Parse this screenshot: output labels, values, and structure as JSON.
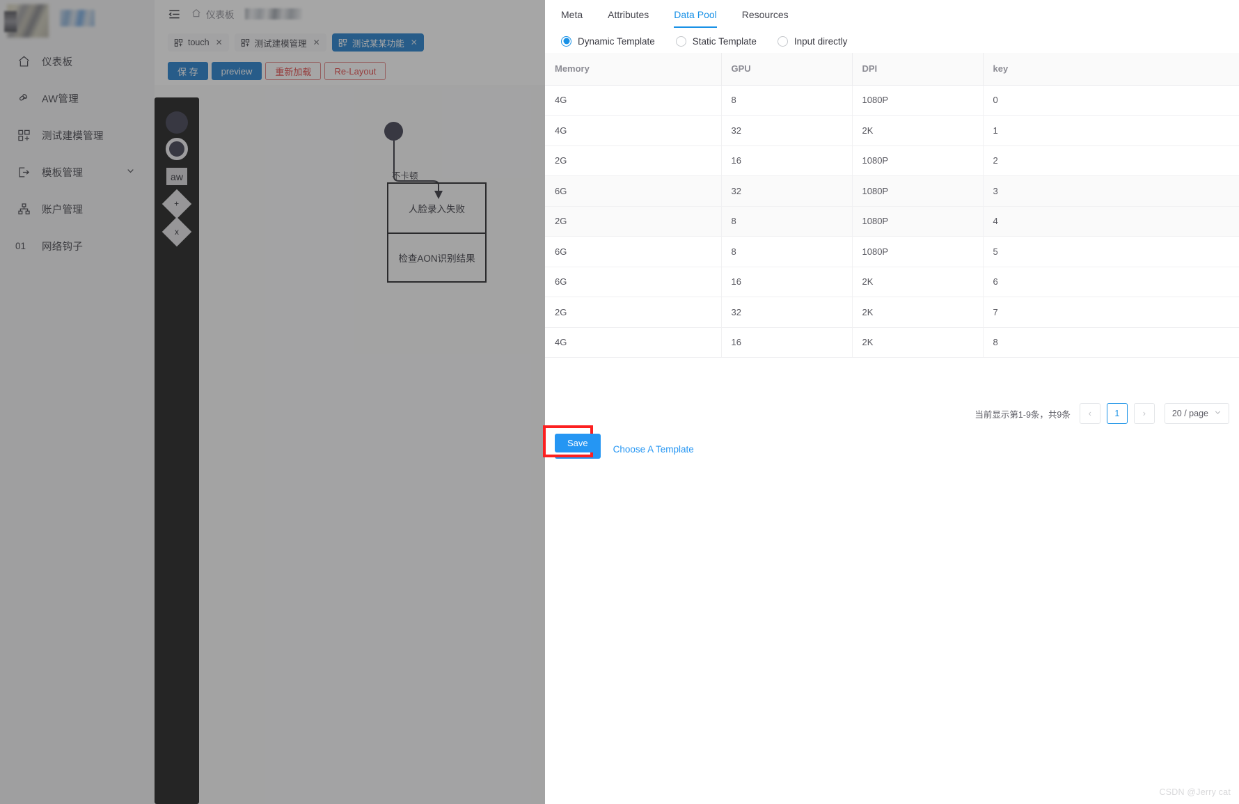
{
  "sidebar": {
    "items": [
      {
        "label": "仪表板",
        "icon": "home-icon",
        "num": ""
      },
      {
        "label": "AW管理",
        "icon": "link-icon",
        "num": ""
      },
      {
        "label": "测试建模管理",
        "icon": "blocks-icon",
        "num": ""
      },
      {
        "label": "模板管理",
        "icon": "template-icon",
        "num": "",
        "caret": "chevron-down-icon"
      },
      {
        "label": "账户管理",
        "icon": "org-icon",
        "num": ""
      },
      {
        "label": "网络钩子",
        "icon": "",
        "num": "01"
      }
    ]
  },
  "topbar": {
    "collapse_icon": "collapse-menu-icon",
    "breadcrumb_home_icon": "home-icon",
    "breadcrumb_home": "仪表板"
  },
  "tabs": [
    {
      "label": "touch",
      "active": false,
      "close": "✕"
    },
    {
      "label": "测试建模管理",
      "active": false,
      "close": "✕"
    },
    {
      "label": "测试某某功能",
      "active": true,
      "close": "✕"
    }
  ],
  "actions": [
    {
      "label": "保 存",
      "style": "primary"
    },
    {
      "label": "preview",
      "style": "primary"
    },
    {
      "label": "重新加载",
      "style": "danger-outline"
    },
    {
      "label": "Re-Layout",
      "style": "danger-outline"
    }
  ],
  "palette": [
    {
      "name": "start-node-shape",
      "glyph": ""
    },
    {
      "name": "end-node-shape",
      "glyph": ""
    },
    {
      "name": "aw-node-shape",
      "glyph": "aw"
    },
    {
      "name": "add-decision-shape",
      "glyph": "+"
    },
    {
      "name": "remove-decision-shape",
      "glyph": "x"
    }
  ],
  "flow": {
    "edge_label": "不卡顿",
    "box_rows": [
      "人脸录入失败",
      "检查AON识别结果"
    ]
  },
  "drawer": {
    "tabs": [
      {
        "label": "Meta",
        "active": false
      },
      {
        "label": "Attributes",
        "active": false
      },
      {
        "label": "Data Pool",
        "active": true
      },
      {
        "label": "Resources",
        "active": false
      }
    ],
    "radios": [
      {
        "label": "Dynamic Template",
        "checked": true
      },
      {
        "label": "Static Template",
        "checked": false
      },
      {
        "label": "Input directly",
        "checked": false
      }
    ],
    "table": {
      "columns": [
        "Memory",
        "GPU",
        "DPI",
        "key"
      ],
      "rows": [
        [
          "4G",
          "8",
          "1080P",
          "0"
        ],
        [
          "4G",
          "32",
          "2K",
          "1"
        ],
        [
          "2G",
          "16",
          "1080P",
          "2"
        ],
        [
          "6G",
          "32",
          "1080P",
          "3"
        ],
        [
          "2G",
          "8",
          "1080P",
          "4"
        ],
        [
          "6G",
          "8",
          "1080P",
          "5"
        ],
        [
          "6G",
          "16",
          "2K",
          "6"
        ],
        [
          "2G",
          "32",
          "2K",
          "7"
        ],
        [
          "4G",
          "16",
          "2K",
          "8"
        ]
      ],
      "striped_row_indexes": [
        3,
        4
      ]
    },
    "pagination": {
      "info": "当前显示第1-9条，共9条",
      "prev": "‹",
      "current_page": "1",
      "next": "›",
      "page_size": "20 / page",
      "page_size_caret": "chevron-down-icon"
    },
    "footer": {
      "save_label": "Save",
      "choose_template_label": "Choose A Template"
    }
  },
  "watermark": "CSDN @Jerry cat",
  "colors": {
    "accent": "#1991e6",
    "primary_button": "#1677c9",
    "save_button": "#2596f3",
    "danger": "#e03a3a",
    "annotation": "#fc2020"
  }
}
